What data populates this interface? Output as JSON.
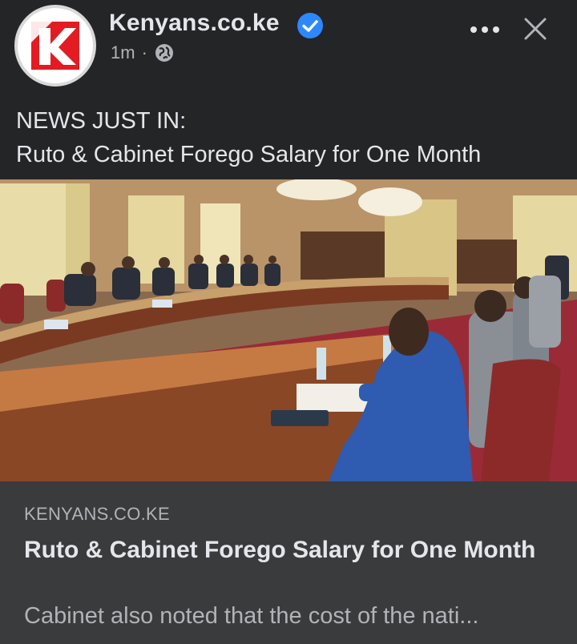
{
  "post": {
    "page_name": "Kenyans.co.ke",
    "timestamp": "1m",
    "separator": "·",
    "audience_icon": "globe-icon",
    "verified_icon": "verified-badge-icon",
    "more_icon": "more-options-icon",
    "close_icon": "close-icon",
    "text_line1": "NEWS JUST IN:",
    "text_line2": "Ruto & Cabinet Forego Salary for One Month"
  },
  "link_card": {
    "domain": "KENYANS.CO.KE",
    "title": "Ruto & Cabinet Forego Salary for One Month",
    "description": "Cabinet also noted that the cost of the nati..."
  },
  "colors": {
    "background": "#242526",
    "card": "#3a3b3c",
    "text_primary": "#e4e6eb",
    "text_secondary": "#b0b3b8",
    "verified_blue": "#2d88ff",
    "logo_red": "#e31b23"
  }
}
